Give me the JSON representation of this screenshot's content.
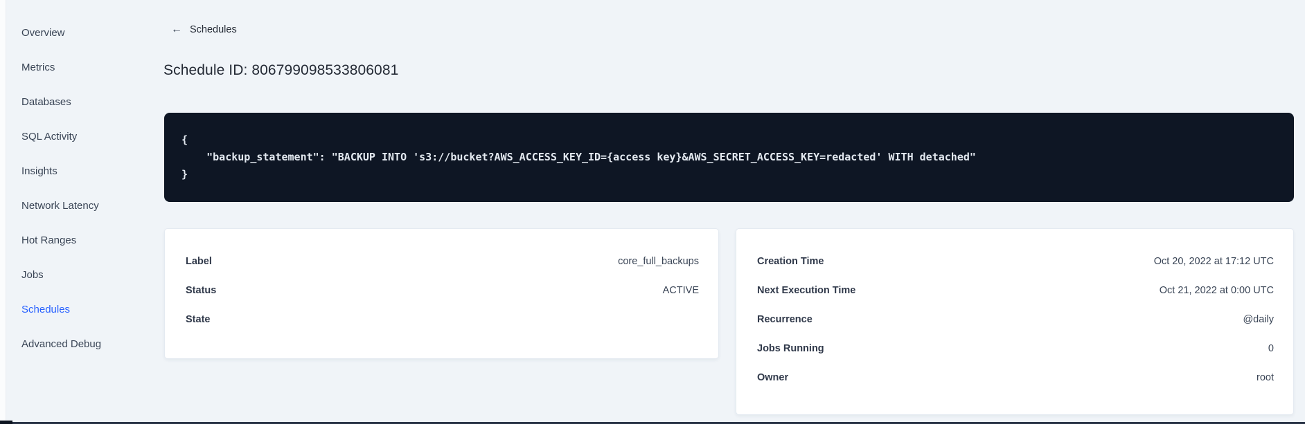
{
  "sidebar": {
    "items": [
      {
        "label": "Overview",
        "active": false
      },
      {
        "label": "Metrics",
        "active": false
      },
      {
        "label": "Databases",
        "active": false
      },
      {
        "label": "SQL Activity",
        "active": false
      },
      {
        "label": "Insights",
        "active": false
      },
      {
        "label": "Network Latency",
        "active": false
      },
      {
        "label": "Hot Ranges",
        "active": false
      },
      {
        "label": "Jobs",
        "active": false
      },
      {
        "label": "Schedules",
        "active": true
      },
      {
        "label": "Advanced Debug",
        "active": false
      }
    ]
  },
  "header": {
    "back_icon": "←",
    "back_label": "Schedules",
    "title": "Schedule ID: 806799098533806081"
  },
  "code_block": {
    "lines": [
      "{",
      "    \"backup_statement\": \"BACKUP INTO 's3://bucket?AWS_ACCESS_KEY_ID={access key}&AWS_SECRET_ACCESS_KEY=redacted' WITH detached\"",
      "}"
    ]
  },
  "left_card": {
    "rows": [
      {
        "label": "Label",
        "value": "core_full_backups"
      },
      {
        "label": "Status",
        "value": "ACTIVE"
      },
      {
        "label": "State",
        "value": ""
      }
    ]
  },
  "right_card": {
    "rows": [
      {
        "label": "Creation Time",
        "value": "Oct 20, 2022 at 17:12 UTC"
      },
      {
        "label": "Next Execution Time",
        "value": "Oct 21, 2022 at 0:00 UTC"
      },
      {
        "label": "Recurrence",
        "value": "@daily"
      },
      {
        "label": "Jobs Running",
        "value": "0"
      },
      {
        "label": "Owner",
        "value": "root"
      }
    ]
  },
  "colors": {
    "page_background": "#f0f4f8",
    "active_nav": "#2962ff",
    "code_background": "#0e1624",
    "code_text": "#e3e9f0",
    "text_primary": "#242a35",
    "text_secondary": "#394455",
    "card_background": "#ffffff"
  }
}
